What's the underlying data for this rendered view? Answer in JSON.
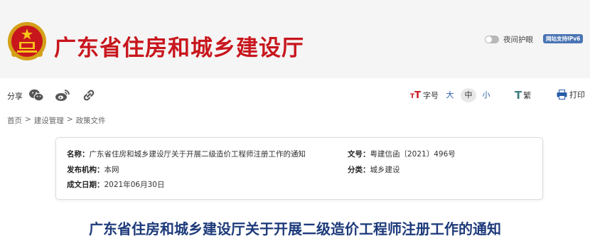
{
  "site": {
    "title": "广东省住房和城乡建设厅"
  },
  "header": {
    "night_mode_label": "夜间护眼",
    "ipv6_badge": "网站支持IPv6"
  },
  "toolbar": {
    "share_label": "分享",
    "font_label": "字号",
    "font_sizes": [
      "大",
      "中",
      "小"
    ],
    "font_selected": "中",
    "traditional_label": "繁",
    "print_label": "打印"
  },
  "breadcrumb": [
    "首页",
    "建设管理",
    "政策文件"
  ],
  "breadcrumb_sep": ">",
  "info": {
    "name_label": "名称：",
    "name": "广东省住房和城乡建设厅关于开展二级造价工程师注册工作的通知",
    "doc_no_label": "文号：",
    "doc_no": "粤建信函〔2021〕496号",
    "issuer_label": "发布机构：",
    "issuer": "本网",
    "category_label": "分类：",
    "category": "城乡建设",
    "date_label": "成文日期：",
    "date": "2021年06月30日"
  },
  "article": {
    "title": "广东省住房和城乡建设厅关于开展二级造价工程师注册工作的通知"
  },
  "colors": {
    "brand_red": "#c8161d",
    "title_blue": "#1d3a7a",
    "link_blue": "#2a5ca8"
  }
}
